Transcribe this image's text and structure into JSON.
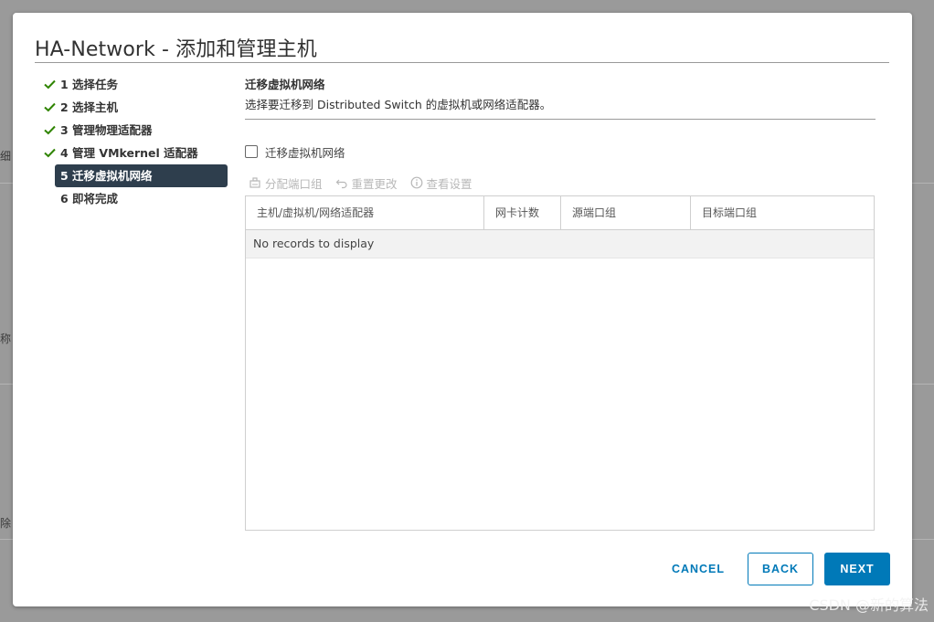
{
  "dialog": {
    "title": "HA-Network - 添加和管理主机"
  },
  "steps": [
    {
      "label": "1 选择任务",
      "completed": true
    },
    {
      "label": "2 选择主机",
      "completed": true
    },
    {
      "label": "3 管理物理适配器",
      "completed": true
    },
    {
      "label": "4 管理 VMkernel 适配器",
      "completed": true
    },
    {
      "label": "5 迁移虚拟机网络",
      "completed": false,
      "active": true
    },
    {
      "label": "6 即将完成",
      "completed": false
    }
  ],
  "section": {
    "title": "迁移虚拟机网络",
    "description": "选择要迁移到 Distributed Switch 的虚拟机或网络适配器。"
  },
  "migrate_checkbox": {
    "label": "迁移虚拟机网络",
    "checked": false
  },
  "toolbar": {
    "assign_port_group": "分配端口组",
    "reset_changes": "重置更改",
    "view_settings": "查看设置"
  },
  "grid": {
    "columns": [
      "主机/虚拟机/网络适配器",
      "网卡计数",
      "源端口组",
      "目标端口组"
    ],
    "empty_message": "No records to display"
  },
  "footer": {
    "cancel": "CANCEL",
    "back": "BACK",
    "next": "NEXT"
  },
  "background_fragments": [
    "细",
    "称",
    "除"
  ],
  "watermark": "CSDN @新的算法",
  "colors": {
    "accent": "#0079b8",
    "active_step_bg": "#2e3e4d",
    "check_green": "#2f8400"
  }
}
